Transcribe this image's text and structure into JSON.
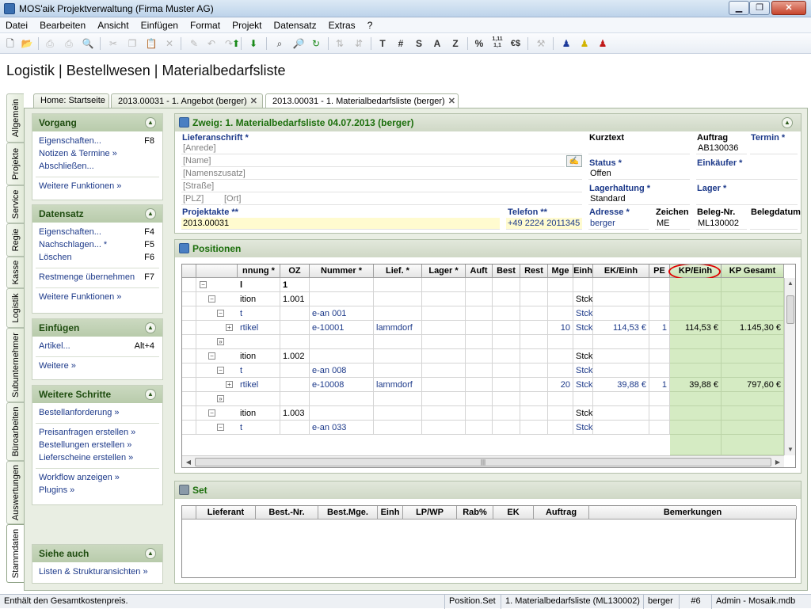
{
  "window": {
    "title": "MOS'aik Projektverwaltung (Firma Muster AG)",
    "min_label": "▁",
    "max_label": "❐",
    "close_label": "✕"
  },
  "menu": [
    "Datei",
    "Bearbeiten",
    "Ansicht",
    "Einfügen",
    "Format",
    "Projekt",
    "Datensatz",
    "Extras",
    "?"
  ],
  "toolbar": {
    "buttons": [
      "new-icon",
      "open-icon",
      "print-icon",
      "print-preview-icon",
      "preview-icon",
      "cut-icon",
      "copy-icon",
      "paste-icon",
      "delete-icon",
      "edit-icon",
      "undo-icon",
      "redo-icon",
      "arrow-up-icon",
      "arrow-down-icon",
      "search-icon",
      "refresh-icon",
      "sort-icon",
      "text-icon",
      "hash-icon",
      "s-icon",
      "a-icon",
      "z-icon",
      "percent-icon",
      "decimal-icon",
      "currency-icon",
      "disabled-icon",
      "user-blue-icon",
      "user-yellow-icon",
      "user-red-icon"
    ],
    "text_labels": {
      "t": "T",
      "hash": "#",
      "s": "S",
      "a": "A",
      "z": "Z",
      "percent": "%",
      "decimal": "1,11\n1,1",
      "currency": "€$"
    }
  },
  "page_title": "Logistik | Bestellwesen | Materialbedarfsliste",
  "vertical_tabs": [
    "Allgemein",
    "Projekte",
    "Service",
    "Regie",
    "Kasse",
    "Logistik",
    "Subunternehmer",
    "Büroarbeiten",
    "Auswertungen",
    "Stammdaten"
  ],
  "doc_tabs": [
    {
      "label": "Home: Startseite",
      "closable": false
    },
    {
      "label": "2013.00031 - 1. Angebot (berger)",
      "closable": true
    },
    {
      "label": "2013.00031 - 1. Materialbedarfsliste (berger)",
      "closable": true
    }
  ],
  "sidebar": {
    "vorgang": {
      "title": "Vorgang",
      "items": [
        {
          "label": "Eigenschaften...",
          "key": "F8"
        },
        {
          "label": "Notizen & Termine »",
          "key": ""
        },
        {
          "label": "Abschließen...",
          "key": ""
        }
      ],
      "more": "Weitere Funktionen »"
    },
    "datensatz": {
      "title": "Datensatz",
      "items": [
        {
          "label": "Eigenschaften...",
          "key": "F4"
        },
        {
          "label": "Nachschlagen... *",
          "key": "F5"
        },
        {
          "label": "Löschen",
          "key": "F6"
        }
      ],
      "extra": {
        "label": "Restmenge übernehmen",
        "key": "F7"
      },
      "more": "Weitere Funktionen »"
    },
    "einfuegen": {
      "title": "Einfügen",
      "items": [
        {
          "label": "Artikel...",
          "key": "Alt+4"
        }
      ],
      "more": "Weitere »"
    },
    "weitere_schritte": {
      "title": "Weitere Schritte",
      "groups": [
        [
          "Bestellanforderung »"
        ],
        [
          "Preisanfragen erstellen »",
          "Bestellungen erstellen »",
          "Lieferscheine erstellen »"
        ],
        [
          "Workflow anzeigen »",
          "Plugins »"
        ]
      ]
    },
    "siehe_auch": {
      "title": "Siehe auch",
      "items": [
        "Listen & Strukturansichten »"
      ]
    }
  },
  "header_panel": {
    "title": "Zweig: 1. Materialbedarfsliste 04.07.2013 (berger)",
    "lieferanschrift_label": "Lieferanschrift *",
    "address_placeholders": {
      "anrede": "[Anrede]",
      "name": "[Name]",
      "namenszusatz": "[Namenszusatz]",
      "strasse": "[Straße]",
      "plz": "[PLZ]",
      "ort": "[Ort]"
    },
    "projektakte_label": "Projektakte **",
    "projektakte": "2013.00031",
    "telefon_label": "Telefon **",
    "telefon": "+49 2224 2011345",
    "kurztext_label": "Kurztext",
    "kurztext": "",
    "auftrag_label": "Auftrag",
    "auftrag": "AB130036",
    "termin_label": "Termin *",
    "termin": "",
    "status_label": "Status *",
    "status": "Offen",
    "einkaeufer_label": "Einkäufer *",
    "einkaeufer": "",
    "lagerhaltung_label": "Lagerhaltung *",
    "lagerhaltung": "Standard",
    "lager_label": "Lager *",
    "lager": "",
    "adresse_label": "Adresse *",
    "adresse": "berger",
    "zeichen_label": "Zeichen",
    "zeichen": "ME",
    "belegnr_label": "Beleg-Nr.",
    "belegnr": "ML130002",
    "belegdatum_label": "Belegdatum",
    "belegdatum": ""
  },
  "positionen": {
    "title": "Positionen",
    "columns": [
      "nnung *",
      "OZ",
      "Nummer *",
      "Lief. *",
      "Lager *",
      "Auft",
      "Best",
      "Rest",
      "Mge",
      "Einh",
      "EK/Einh",
      "PE",
      "KP/Einh",
      "KP Gesamt"
    ],
    "rows": [
      {
        "tree": "minus",
        "indent": 0,
        "bez": "l",
        "oz": "1",
        "nummer": "",
        "lief": "",
        "mge": "",
        "einh": "",
        "ek": "",
        "pe": "",
        "kp": "",
        "kpg": "",
        "bold": true,
        "blue": false
      },
      {
        "tree": "minus",
        "indent": 1,
        "bez": "ition",
        "oz": "1.001",
        "nummer": "",
        "lief": "",
        "mge": "",
        "einh": "Stck",
        "ek": "",
        "pe": "",
        "kp": "",
        "kpg": "",
        "bold": false,
        "blue": false
      },
      {
        "tree": "minus",
        "indent": 2,
        "bez": "t",
        "oz": "",
        "nummer": "e-an 001",
        "lief": "",
        "mge": "",
        "einh": "Stck",
        "ek": "",
        "pe": "",
        "kp": "",
        "kpg": "",
        "bold": false,
        "blue": true
      },
      {
        "tree": "plus",
        "indent": 3,
        "bez": "rtikel",
        "oz": "",
        "nummer": "e-10001",
        "lief": "lammdorf",
        "mge": "10",
        "einh": "Stck",
        "ek": "114,53 €",
        "pe": "1",
        "kp": "114,53 €",
        "kpg": "1.145,30 €",
        "bold": false,
        "blue": true
      },
      {
        "tree": "arrow",
        "indent": 2,
        "bez": "",
        "oz": "",
        "nummer": "",
        "lief": "",
        "mge": "",
        "einh": "",
        "ek": "",
        "pe": "",
        "kp": "",
        "kpg": "",
        "bold": false,
        "blue": false
      },
      {
        "tree": "minus",
        "indent": 1,
        "bez": "ition",
        "oz": "1.002",
        "nummer": "",
        "lief": "",
        "mge": "",
        "einh": "Stck",
        "ek": "",
        "pe": "",
        "kp": "",
        "kpg": "",
        "bold": false,
        "blue": false
      },
      {
        "tree": "minus",
        "indent": 2,
        "bez": "t",
        "oz": "",
        "nummer": "e-an 008",
        "lief": "",
        "mge": "",
        "einh": "Stck",
        "ek": "",
        "pe": "",
        "kp": "",
        "kpg": "",
        "bold": false,
        "blue": true
      },
      {
        "tree": "plus",
        "indent": 3,
        "bez": "rtikel",
        "oz": "",
        "nummer": "e-10008",
        "lief": "lammdorf",
        "mge": "20",
        "einh": "Stck",
        "ek": "39,88 €",
        "pe": "1",
        "kp": "39,88 €",
        "kpg": "797,60 €",
        "bold": false,
        "blue": true
      },
      {
        "tree": "arrow",
        "indent": 2,
        "bez": "",
        "oz": "",
        "nummer": "",
        "lief": "",
        "mge": "",
        "einh": "",
        "ek": "",
        "pe": "",
        "kp": "",
        "kpg": "",
        "bold": false,
        "blue": false
      },
      {
        "tree": "minus",
        "indent": 1,
        "bez": "ition",
        "oz": "1.003",
        "nummer": "",
        "lief": "",
        "mge": "",
        "einh": "Stck",
        "ek": "",
        "pe": "",
        "kp": "",
        "kpg": "",
        "bold": false,
        "blue": false
      },
      {
        "tree": "minus",
        "indent": 2,
        "bez": "t",
        "oz": "",
        "nummer": "e-an 033",
        "lief": "",
        "mge": "",
        "einh": "Stck",
        "ek": "",
        "pe": "",
        "kp": "",
        "kpg": "",
        "bold": false,
        "blue": true
      }
    ]
  },
  "set_panel": {
    "title": "Set",
    "columns": [
      "Lieferant",
      "Best.-Nr.",
      "Best.Mge.",
      "Einh",
      "LP/WP",
      "Rab%",
      "EK",
      "Auftrag",
      "Bemerkungen"
    ]
  },
  "statusbar": {
    "message": "Enthält den Gesamtkostenpreis.",
    "context": "Position.Set",
    "document": "1. Materialbedarfsliste (ML130002)",
    "user": "berger",
    "number": "#6",
    "database": "Admin - Mosaik.mdb"
  },
  "colors": {
    "accent_green": "#1c6f0c",
    "link_blue": "#1d3a8a",
    "kp_highlight": "#d5ebc3",
    "annotation_red": "#e00000"
  }
}
